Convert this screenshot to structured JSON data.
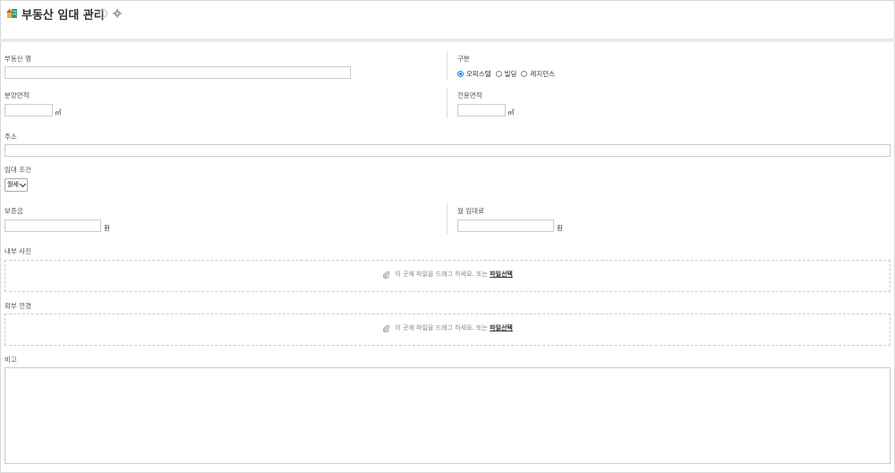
{
  "header": {
    "title": "부동산 임대 관리",
    "info_icon": "info-icon",
    "settings_icon": "gear-icon"
  },
  "form": {
    "property_name": {
      "label": "부동산 명",
      "value": ""
    },
    "category": {
      "label": "구분",
      "options": [
        "오피스텔",
        "빌딩",
        "레지던스"
      ],
      "selected": "오피스텔"
    },
    "sale_area": {
      "label": "분양면적",
      "value": "",
      "unit": "㎡"
    },
    "exclusive_area": {
      "label": "전용면적",
      "value": "",
      "unit": "㎡"
    },
    "address": {
      "label": "주소",
      "value": ""
    },
    "lease_terms": {
      "label": "임대 조건",
      "selected": "월세"
    },
    "deposit": {
      "label": "보증금",
      "value": "",
      "unit": "원"
    },
    "monthly_rent": {
      "label": "월 임대료",
      "value": "",
      "unit": "원"
    },
    "interior_photos": {
      "label": "내부 사진",
      "drop_text": "이 곳에 파일을 드래그 하세요. 또는",
      "link_text": "파일선택"
    },
    "exterior_view": {
      "label": "외부 전경",
      "drop_text": "이 곳에 파일을 드래그 하세요. 또는",
      "link_text": "파일선택"
    },
    "remarks": {
      "label": "비고",
      "value": ""
    }
  },
  "colors": {
    "accent": "#1a73e8",
    "border": "#cccccc",
    "header_bar": "#e9e9e9"
  }
}
